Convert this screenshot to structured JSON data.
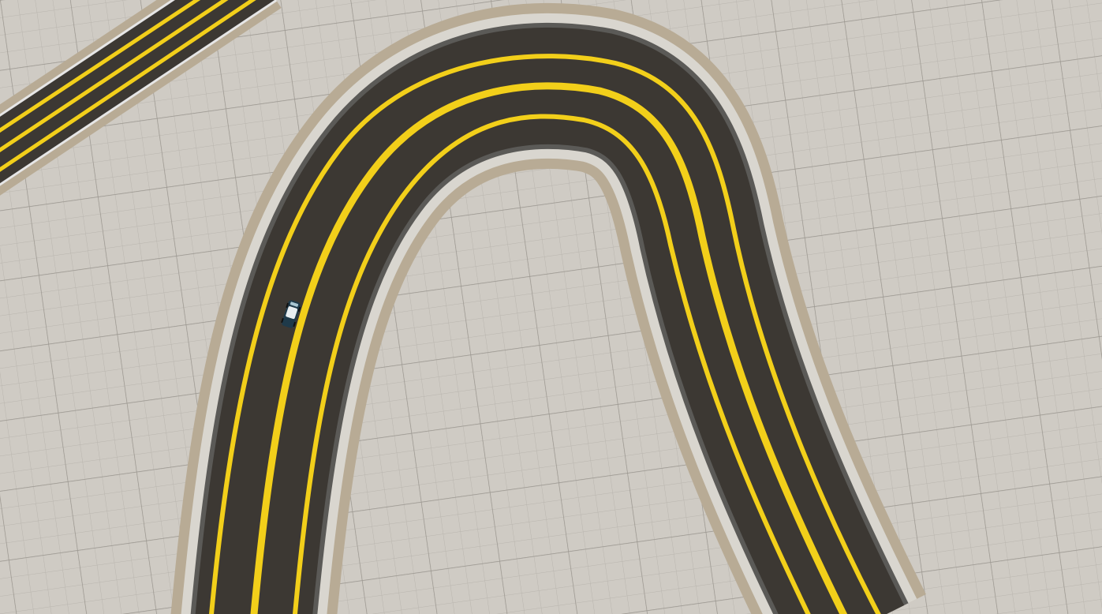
{
  "scene": {
    "kind": "top-down racing track view",
    "colors": {
      "ground": "#cfcbc4",
      "grid_minor": "#b9b5ae",
      "grid_major": "#8f8b85",
      "curb_outer": "#b8ab95",
      "curb_inner_shadow": "#5b5a57",
      "edge_white": "#e6e6e6",
      "asphalt": "#3c3833",
      "lane_yellow": "#f2cf1a",
      "car_body": "#1f3a4a",
      "car_roof": "#e9eef0"
    }
  },
  "objects": {
    "track_main": {
      "icon": "hairpin-road"
    },
    "track_secondary": {
      "icon": "straight-road"
    },
    "car": {
      "icon": "race-car-icon"
    }
  }
}
